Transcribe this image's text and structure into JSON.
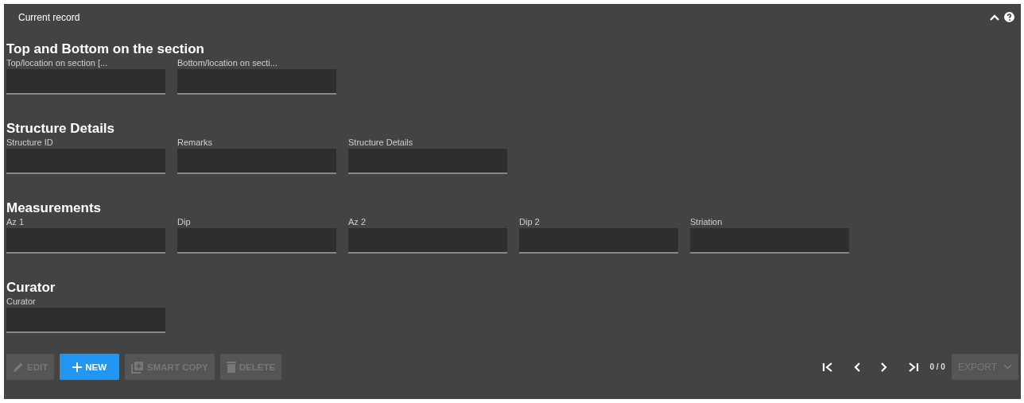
{
  "panel": {
    "title": "Current record"
  },
  "sections": [
    {
      "heading": "Top and Bottom on the section",
      "fields": [
        {
          "label": "Top/location on section [..."
        },
        {
          "label": "Bottom/location on secti..."
        }
      ]
    },
    {
      "heading": "Structure Details",
      "fields": [
        {
          "label": "Structure ID"
        },
        {
          "label": "Remarks"
        },
        {
          "label": "Structure Details"
        }
      ]
    },
    {
      "heading": "Measurements",
      "fields": [
        {
          "label": "Az 1"
        },
        {
          "label": "Dip"
        },
        {
          "label": "Az 2"
        },
        {
          "label": "Dip 2"
        },
        {
          "label": "Striation"
        }
      ]
    },
    {
      "heading": "Curator",
      "fields": [
        {
          "label": "Curator"
        }
      ]
    }
  ],
  "actions": [
    {
      "kind": "edit",
      "label": "EDIT",
      "disabled": true
    },
    {
      "kind": "new",
      "label": "NEW",
      "disabled": false
    },
    {
      "kind": "copy",
      "label": "SMART COPY",
      "disabled": true
    },
    {
      "kind": "delete",
      "label": "DELETE",
      "disabled": true
    }
  ],
  "pager": {
    "count": "0 / 0"
  },
  "export": {
    "label": "EXPORT",
    "disabled": true
  }
}
